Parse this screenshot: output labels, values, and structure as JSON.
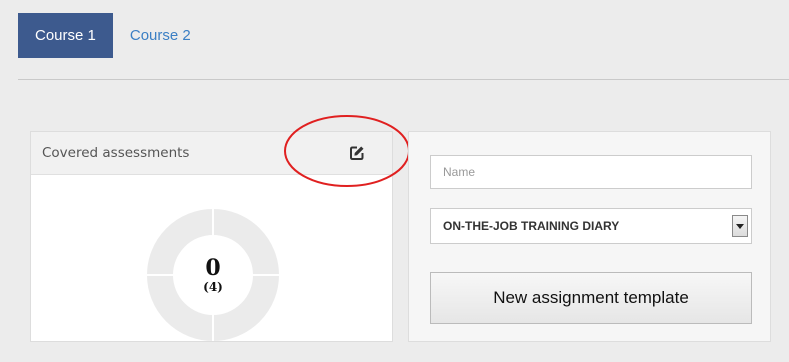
{
  "tabs": [
    {
      "label": "Course 1",
      "active": true
    },
    {
      "label": "Course 2",
      "active": false
    }
  ],
  "covered_panel": {
    "title": "Covered assessments",
    "edit_icon": "edit-icon",
    "donut": {
      "value": "0",
      "sub": "(4)",
      "ring_color": "#ebebeb"
    }
  },
  "form": {
    "name_placeholder": "Name",
    "type_select_value": "ON-THE-JOB TRAINING DIARY",
    "new_template_label": "New assignment template"
  },
  "colors": {
    "active_tab": "#3d5a8e",
    "link": "#3b7fc4",
    "annotation": "#e02020"
  }
}
